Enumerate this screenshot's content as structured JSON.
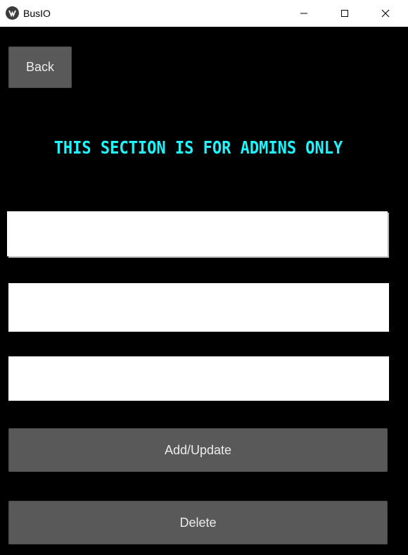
{
  "window": {
    "title": "BusIO",
    "minimize_icon": "minimize-icon",
    "maximize_icon": "maximize-icon",
    "close_icon": "close-icon"
  },
  "nav": {
    "back_label": "Back"
  },
  "heading": {
    "text": "THIS SECTION IS FOR ADMINS ONLY",
    "color": "#1ff6ff"
  },
  "form": {
    "field_1": {
      "value": ""
    },
    "field_2": {
      "value": ""
    },
    "field_3": {
      "value": ""
    },
    "add_update_label": "Add/Update",
    "delete_label": "Delete"
  },
  "colors": {
    "background": "#000000",
    "button": "#595959",
    "button_text": "#ececec"
  }
}
